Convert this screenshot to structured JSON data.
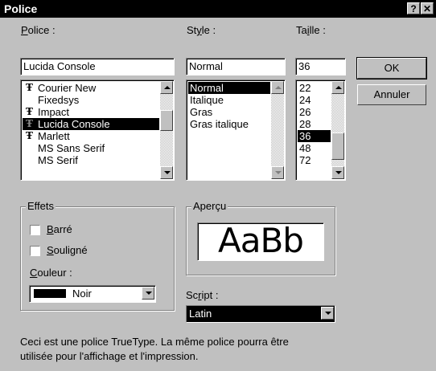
{
  "window": {
    "title": "Police",
    "help_label": "?",
    "close_label": "✕"
  },
  "font": {
    "label": "Police :",
    "mnemonic": "P",
    "rest": "olice :",
    "value": "Lucida Console",
    "items": [
      {
        "name": "Courier New",
        "truetype": true,
        "selected": false
      },
      {
        "name": "Fixedsys",
        "truetype": false,
        "selected": false
      },
      {
        "name": "Impact",
        "truetype": true,
        "selected": false
      },
      {
        "name": "Lucida Console",
        "truetype": true,
        "selected": true
      },
      {
        "name": "Marlett",
        "truetype": true,
        "selected": false
      },
      {
        "name": "MS Sans Serif",
        "truetype": false,
        "selected": false
      },
      {
        "name": "MS Serif",
        "truetype": false,
        "selected": false
      }
    ]
  },
  "style": {
    "label_pre": "St",
    "mnemonic": "y",
    "label_post": "le :",
    "value": "Normal",
    "items": [
      {
        "name": "Normal",
        "selected": true
      },
      {
        "name": "Italique",
        "selected": false
      },
      {
        "name": "Gras",
        "selected": false
      },
      {
        "name": "Gras italique",
        "selected": false
      }
    ]
  },
  "size": {
    "label_pre": "Ta",
    "mnemonic": "i",
    "label_post": "lle :",
    "value": "36",
    "items": [
      {
        "name": "22",
        "selected": false
      },
      {
        "name": "24",
        "selected": false
      },
      {
        "name": "26",
        "selected": false
      },
      {
        "name": "28",
        "selected": false
      },
      {
        "name": "36",
        "selected": true
      },
      {
        "name": "48",
        "selected": false
      },
      {
        "name": "72",
        "selected": false
      }
    ]
  },
  "buttons": {
    "ok": "OK",
    "cancel": "Annuler"
  },
  "effects": {
    "title": "Effets",
    "strike_mn": "B",
    "strike_rest": "arré",
    "underline_mn": "S",
    "underline_rest": "ouligné",
    "color_mn": "C",
    "color_rest": "ouleur :",
    "color_value": "Noir",
    "color_swatch": "#000000"
  },
  "preview": {
    "title": "Aperçu",
    "sample": "AaBb"
  },
  "script": {
    "label_pre": "Sc",
    "mnemonic": "r",
    "label_post": "ipt :",
    "value": "Latin"
  },
  "info": {
    "line1": "Ceci est une police TrueType. La même police pourra être",
    "line2": "utilisée pour l'affichage et l'impression."
  },
  "icons": {
    "truetype_icon": "Ŧ"
  }
}
